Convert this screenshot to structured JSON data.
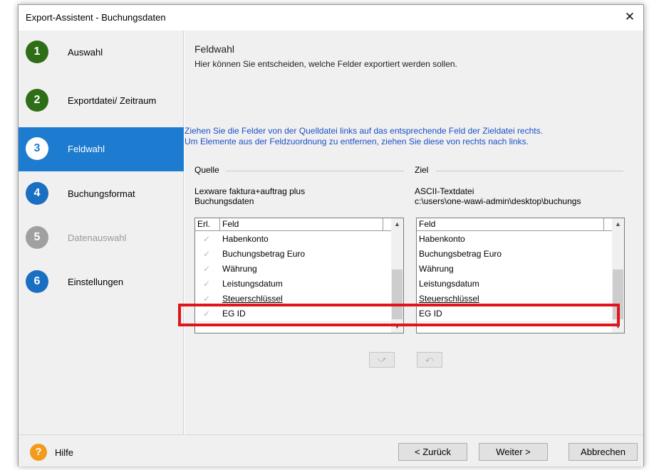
{
  "window": {
    "title": "Export-Assistent - Buchungsdaten",
    "close_glyph": "✕"
  },
  "steps": [
    {
      "number": "1",
      "label": "Auswahl",
      "state": "done"
    },
    {
      "number": "2",
      "label": "Exportdatei/ Zeitraum",
      "state": "done"
    },
    {
      "number": "3",
      "label": "Feldwahl",
      "state": "active"
    },
    {
      "number": "4",
      "label": "Buchungsformat",
      "state": "todo"
    },
    {
      "number": "5",
      "label": "Datenauswahl",
      "state": "disabled"
    },
    {
      "number": "6",
      "label": "Einstellungen",
      "state": "todo"
    }
  ],
  "page": {
    "title": "Feldwahl",
    "description": "Hier können Sie entscheiden, welche Felder exportiert werden sollen.",
    "instruction_line1": "Ziehen Sie die Felder von der Quelldatei links auf das entsprechende Feld der Zieldatei rechts.",
    "instruction_line2": "Um Elemente aus der Feldzuordnung zu entfernen, ziehen Sie diese von rechts nach links."
  },
  "source": {
    "group_label": "Quelle",
    "name_line1": "Lexware faktura+auftrag plus",
    "name_line2": "Buchungsdaten",
    "col_erl": "Erl.",
    "col_feld": "Feld",
    "check_glyph": "✓",
    "rows": [
      "Habenkonto",
      "Buchungsbetrag Euro",
      "Währung",
      "Leistungsdatum",
      "Steuerschlüssel",
      "EG ID"
    ]
  },
  "target": {
    "group_label": "Ziel",
    "name_line1": "ASCII-Textdatei",
    "name_line2": "c:\\users\\one-wawi-admin\\desktop\\buchungs",
    "col_feld": "Feld",
    "rows": [
      "Habenkonto",
      "Buchungsbetrag Euro",
      "Währung",
      "Leistungsdatum",
      "Steuerschlüssel",
      "EG ID"
    ]
  },
  "scroll": {
    "up": "▲",
    "down": "▼"
  },
  "mapping_buttons": {
    "assign": "⤻",
    "remove": "⤺"
  },
  "footer": {
    "help_icon": "?",
    "help_label": "Hilfe",
    "back": "< Zurück",
    "next": "Weiter >",
    "cancel": "Abbrechen"
  },
  "colors": {
    "done": "#2e6e17",
    "active": "#1d7ccf",
    "todo": "#1a6fc2",
    "disabled": "#a0a0a0",
    "highlight": "#e0141c",
    "help": "#f29a1c"
  }
}
